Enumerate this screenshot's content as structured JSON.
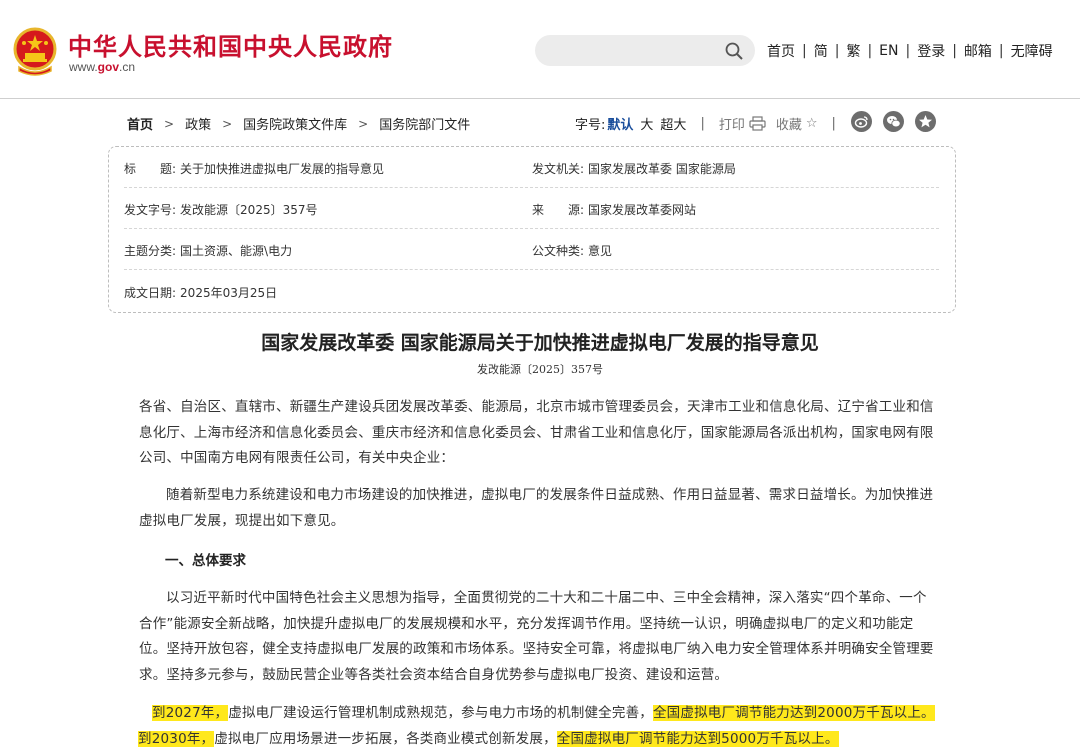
{
  "header": {
    "site_name": "中华人民共和国中央人民政府",
    "site_url_prefix": "www.",
    "site_url_brand": "gov",
    "site_url_suffix": ".cn",
    "search_placeholder": "",
    "nav": [
      "首页",
      "简",
      "繁",
      "EN",
      "登录",
      "邮箱",
      "无障碍"
    ],
    "brand_color": "#c8102e"
  },
  "breadcrumb": [
    "首页",
    "政策",
    "国务院政策文件库",
    "国务院部门文件"
  ],
  "tools": {
    "font_label": "字号:",
    "font_default": "默认",
    "font_large": "大",
    "font_xlarge": "超大",
    "print_label": "打印",
    "favorite_label": "收藏",
    "share_icons": [
      "weibo-icon",
      "wechat-icon",
      "star-icon"
    ]
  },
  "info": {
    "title_label": "标　　题:",
    "title_value": "关于加快推进虚拟电厂发展的指导意见",
    "issuer_label": "发文机关:",
    "issuer_value": "国家发展改革委 国家能源局",
    "doc_no_label": "发文字号:",
    "doc_no_value": "发改能源〔2025〕357号",
    "source_label": "来　　源:",
    "source_value": "国家发展改革委网站",
    "category_label": "主题分类:",
    "category_value": "国土资源、能源\\电力",
    "type_label": "公文种类:",
    "type_value": "意见",
    "date_label": "成文日期:",
    "date_value": "2025年03月25日"
  },
  "article": {
    "title": "国家发展改革委 国家能源局关于加快推进虚拟电厂发展的指导意见",
    "number": "发改能源〔2025〕357号",
    "recipients": "各省、自治区、直辖市、新疆生产建设兵团发展改革委、能源局，北京市城市管理委员会，天津市工业和信息化局、辽宁省工业和信息化厅、上海市经济和信息化委员会、重庆市经济和信息化委员会、甘肃省工业和信息化厅，国家能源局各派出机构，国家电网有限公司、中国南方电网有限责任公司，有关中央企业：",
    "intro": "随着新型电力系统建设和电力市场建设的加快推进，虚拟电厂的发展条件日益成熟、作用日益显著、需求日益增长。为加快推进虚拟电厂发展，现提出如下意见。",
    "section1_heading": "一、总体要求",
    "section1_body": "以习近平新时代中国特色社会主义思想为指导，全面贯彻党的二十大和二十届二中、三中全会精神，深入落实“四个革命、一个合作”能源安全新战略，加快提升虚拟电厂的发展规模和水平，充分发挥调节作用。坚持统一认识，明确虚拟电厂的定义和功能定位。坚持开放包容，健全支持虚拟电厂发展的政策和市场体系。坚持安全可靠，将虚拟电厂纳入电力安全管理体系并明确安全管理要求。坚持多元参与，鼓励民营企业等各类社会资本结合自身优势参与虚拟电厂投资、建设和运营。",
    "goal_2027_year": "到2027年，",
    "goal_2027_text": "虚拟电厂建设运行管理机制成熟规范，参与电力市场的机制健全完善，",
    "goal_2027_capacity": "全国虚拟电厂调节能力达到2000万千瓦以上。",
    "goal_2030_year": "到2030年，",
    "goal_2030_text": "虚拟电厂应用场景进一步拓展，各类商业模式创新发展，",
    "goal_2030_capacity": "全国虚拟电厂调节能力达到5000万千瓦以上。",
    "highlight_color": "#ffe81c"
  }
}
